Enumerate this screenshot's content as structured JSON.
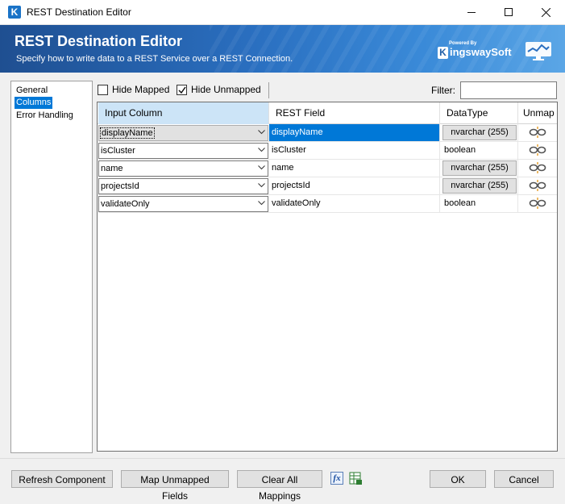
{
  "window": {
    "title": "REST Destination Editor"
  },
  "banner": {
    "title": "REST Destination Editor",
    "subtitle": "Specify how to write data to a REST Service over a REST Connection.",
    "logo_powered": "Powered By",
    "logo_brand": "ingswaySoft"
  },
  "nav": {
    "items": [
      {
        "label": "General",
        "selected": false
      },
      {
        "label": "Columns",
        "selected": true
      },
      {
        "label": "Error Handling",
        "selected": false
      }
    ]
  },
  "toolbar": {
    "hide_mapped_label": "Hide Mapped",
    "hide_mapped_checked": false,
    "hide_unmapped_label": "Hide Unmapped",
    "hide_unmapped_checked": true,
    "filter_label": "Filter:",
    "filter_value": ""
  },
  "grid": {
    "headers": {
      "input": "Input Column",
      "field": "REST Field",
      "type": "DataType",
      "unmap": "Unmap"
    },
    "rows": [
      {
        "input": "displayName",
        "field": "displayName",
        "type": "nvarchar (255)",
        "type_button": true,
        "selected": true
      },
      {
        "input": "isCluster",
        "field": "isCluster",
        "type": "boolean",
        "type_button": false,
        "selected": false
      },
      {
        "input": "name",
        "field": "name",
        "type": "nvarchar (255)",
        "type_button": true,
        "selected": false
      },
      {
        "input": "projectsId",
        "field": "projectsId",
        "type": "nvarchar (255)",
        "type_button": true,
        "selected": false
      },
      {
        "input": "validateOnly",
        "field": "validateOnly",
        "type": "boolean",
        "type_button": false,
        "selected": false
      }
    ]
  },
  "buttons": {
    "refresh": "Refresh Component",
    "map_unmapped": "Map Unmapped Fields",
    "clear_all": "Clear All Mappings",
    "fx": "fx",
    "ok": "OK",
    "cancel": "Cancel"
  },
  "colors": {
    "selection": "#0078d7",
    "banner_start": "#1f4f91",
    "banner_end": "#5ba6e6",
    "header_highlight": "#cce4f7"
  },
  "icons": {
    "app": "kingswaysoft-k-icon",
    "monitor": "monitor-chart-icon",
    "unmap": "unlink-chain-icon",
    "chevron": "chevron-down-icon",
    "expression": "fx-expression-icon",
    "sheet": "spreadsheet-icon"
  }
}
